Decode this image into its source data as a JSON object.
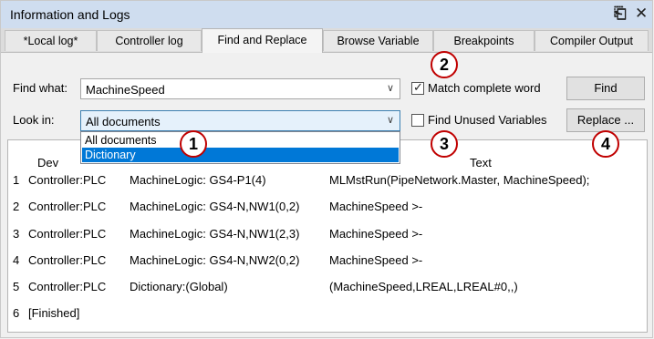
{
  "window": {
    "title": "Information and Logs"
  },
  "tabs": [
    {
      "label": "*Local log*"
    },
    {
      "label": "Controller log"
    },
    {
      "label": "Find and Replace"
    },
    {
      "label": "Browse Variable"
    },
    {
      "label": "Breakpoints"
    },
    {
      "label": "Compiler Output"
    }
  ],
  "form": {
    "find_what_label": "Find what:",
    "find_what_value": "MachineSpeed",
    "look_in_label": "Look in:",
    "look_in_value": "All documents",
    "match_complete_word": {
      "label": "Match complete word",
      "checked": true
    },
    "find_unused": {
      "label": "Find Unused Variables",
      "checked": false
    },
    "find_button": "Find",
    "replace_button": "Replace ..."
  },
  "dropdown": {
    "options": [
      "All documents",
      "Dictionary"
    ],
    "selected": "Dictionary"
  },
  "results": {
    "headers": [
      "Dev",
      "Text"
    ],
    "rows": [
      {
        "num": "1",
        "device": "Controller:PLC",
        "location": "MachineLogic: GS4-P1(4)",
        "text": "MLMstRun(PipeNetwork.Master, MachineSpeed);"
      },
      {
        "num": "2",
        "device": "Controller:PLC",
        "location": "MachineLogic: GS4-N,NW1(0,2)",
        "text": "MachineSpeed >-"
      },
      {
        "num": "3",
        "device": "Controller:PLC",
        "location": "MachineLogic: GS4-N,NW1(2,3)",
        "text": "MachineSpeed >-"
      },
      {
        "num": "4",
        "device": "Controller:PLC",
        "location": "MachineLogic: GS4-N,NW2(0,2)",
        "text": "MachineSpeed >-"
      },
      {
        "num": "5",
        "device": "Controller:PLC",
        "location": "Dictionary:(Global)",
        "text": "(MachineSpeed,LREAL,LREAL#0,,)"
      },
      {
        "num": "6",
        "device": "[Finished]",
        "location": "",
        "text": ""
      }
    ]
  },
  "callouts": [
    "1",
    "2",
    "3",
    "4"
  ],
  "colors": {
    "titlebar": "#cfddef",
    "selection": "#0078d7",
    "callout": "#c00000"
  }
}
